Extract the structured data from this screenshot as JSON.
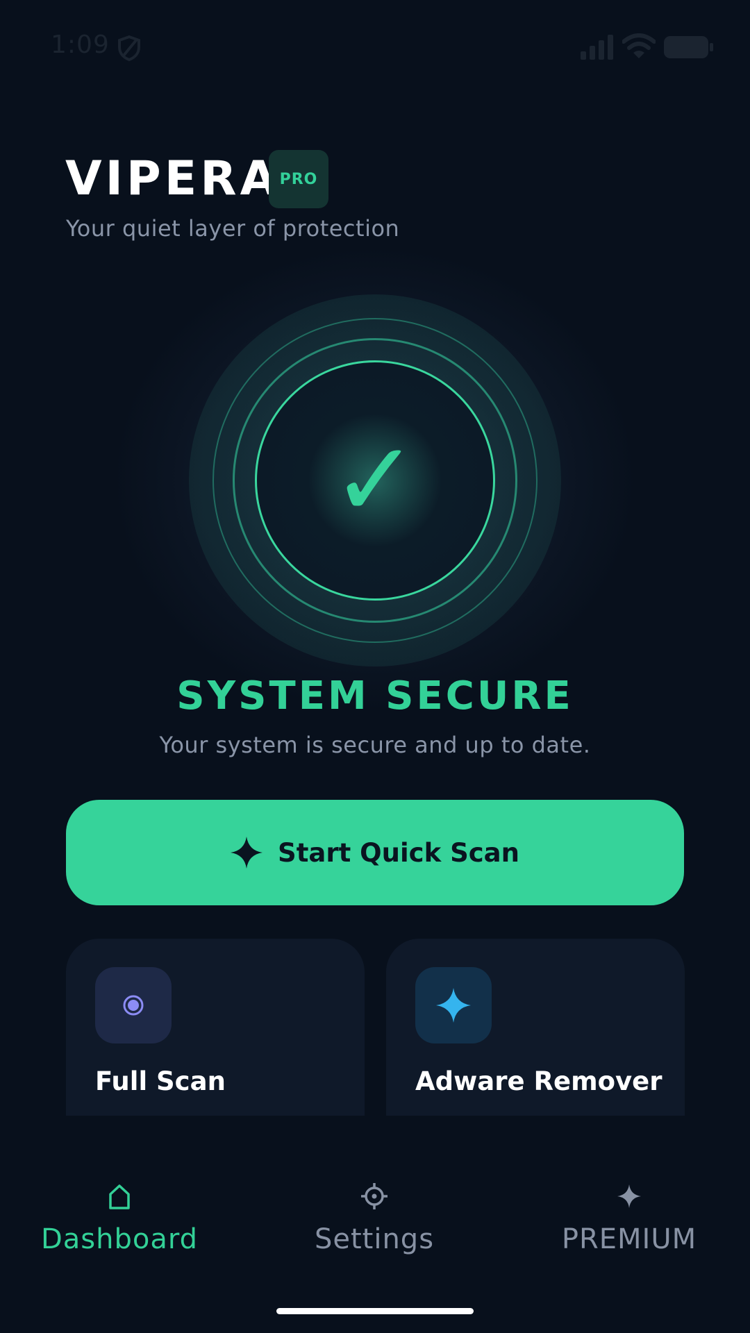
{
  "status_bar": {
    "time": "1:09",
    "icons": [
      "shield-icon",
      "signal-icon",
      "wifi-icon",
      "battery-icon"
    ]
  },
  "header": {
    "title": "VIPERA",
    "badge": "PRO",
    "tagline": "Your quiet layer of protection"
  },
  "protection_status": {
    "icon": "check-icon",
    "check_glyph": "✓",
    "title": "SYSTEM SECURE",
    "subtitle": "Your system is secure and up to date."
  },
  "primary_action": {
    "label": "Start Quick Scan",
    "icon": "sparkle-icon"
  },
  "features": [
    {
      "label": "Full Scan",
      "icon": "radar-dot-icon"
    },
    {
      "label": "Adware Remover",
      "icon": "sparkle-icon"
    }
  ],
  "bottom_nav": {
    "active": "Dashboard",
    "items": [
      {
        "label": "Dashboard",
        "icon": "home-icon"
      },
      {
        "label": "Settings",
        "icon": "gear-icon"
      },
      {
        "label": "PREMIUM",
        "icon": "sparkle-icon"
      }
    ]
  },
  "colors": {
    "background": "#08101c",
    "accent": "#36d39a",
    "card": "#0f1929",
    "muted_text": "#8a95a8",
    "full_scan_icon": "#8c8cf5",
    "adware_icon": "#35b4ee"
  }
}
